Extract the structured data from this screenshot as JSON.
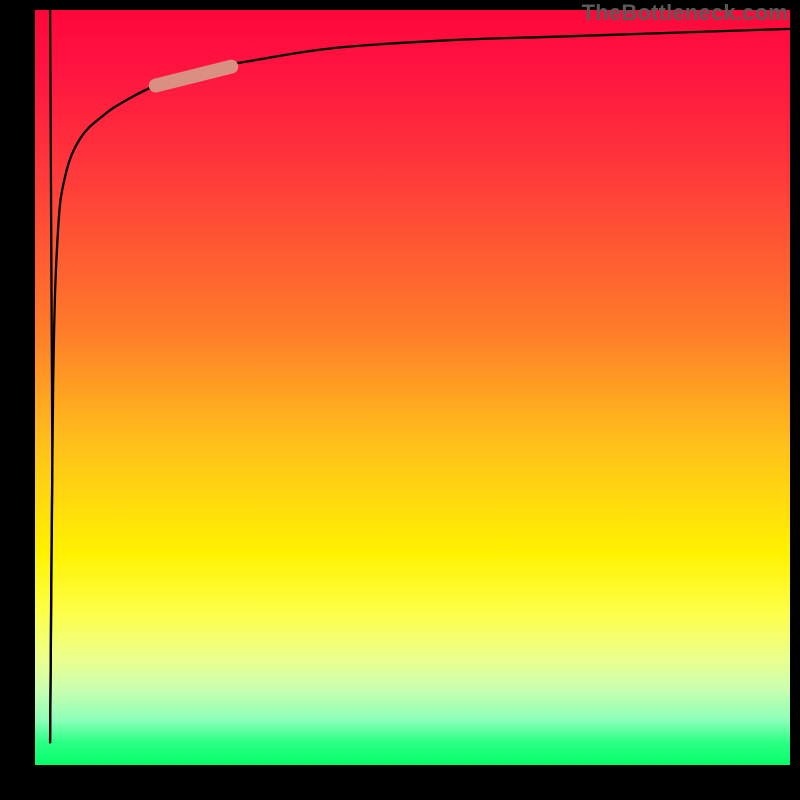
{
  "attribution": "TheBottleneck.com",
  "chart_data": {
    "type": "line",
    "title": "",
    "xlabel": "",
    "ylabel": "",
    "xlim": [
      0,
      100
    ],
    "ylim": [
      0,
      100
    ],
    "series": [
      {
        "name": "bottleneck-curve",
        "x": [
          2,
          2.4,
          3,
          4,
          6,
          9,
          12,
          16,
          22,
          30,
          40,
          55,
          70,
          85,
          100
        ],
        "values": [
          3,
          50,
          70,
          78,
          83,
          86,
          88,
          90,
          92,
          93.5,
          95,
          96,
          96.5,
          97,
          97.5
        ]
      },
      {
        "name": "curve-highlight",
        "x": [
          16,
          26
        ],
        "values": [
          90,
          92.5
        ]
      },
      {
        "name": "initial-drop",
        "x": [
          2,
          2.3,
          2
        ],
        "values": [
          100,
          40,
          3
        ]
      }
    ]
  }
}
